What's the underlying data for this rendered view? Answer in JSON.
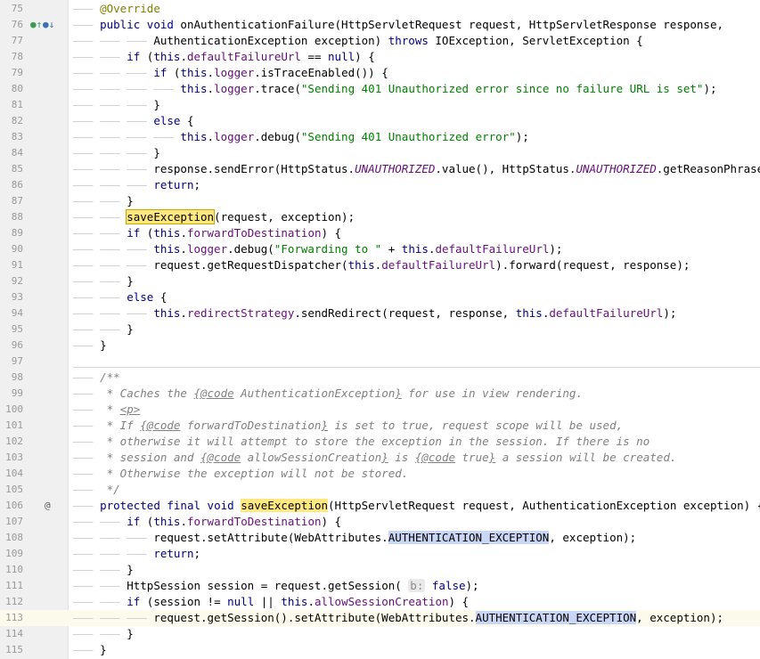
{
  "editor": {
    "current_line": "113",
    "lines": [
      {
        "n": "75",
        "t": [
          [
            "ind",
            "——— "
          ],
          [
            "ann",
            "@Override"
          ]
        ]
      },
      {
        "n": "76",
        "g": "override",
        "t": [
          [
            "ind",
            "——— "
          ],
          [
            "kw",
            "public"
          ],
          [
            "p",
            " "
          ],
          [
            "kw",
            "void"
          ],
          [
            "p",
            " onAuthenticationFailure(HttpServletRequest request, HttpServletResponse response,"
          ]
        ]
      },
      {
        "n": "77",
        "t": [
          [
            "ind",
            "——— ——— ——— "
          ],
          [
            "p",
            "AuthenticationException exception) "
          ],
          [
            "kw",
            "throws"
          ],
          [
            "p",
            " IOException, ServletException {"
          ]
        ]
      },
      {
        "n": "78",
        "t": [
          [
            "ind",
            "——— ——— "
          ],
          [
            "kw",
            "if"
          ],
          [
            "p",
            " ("
          ],
          [
            "kw",
            "this"
          ],
          [
            "p",
            "."
          ],
          [
            "fld",
            "defaultFailureUrl"
          ],
          [
            "p",
            " == "
          ],
          [
            "kw",
            "null"
          ],
          [
            "p",
            ") {"
          ]
        ]
      },
      {
        "n": "79",
        "t": [
          [
            "ind",
            "——— ——— ——— "
          ],
          [
            "kw",
            "if"
          ],
          [
            "p",
            " ("
          ],
          [
            "kw",
            "this"
          ],
          [
            "p",
            "."
          ],
          [
            "fld",
            "logger"
          ],
          [
            "p",
            ".isTraceEnabled()) {"
          ]
        ]
      },
      {
        "n": "80",
        "t": [
          [
            "ind",
            "——— ——— ——— ——— "
          ],
          [
            "kw",
            "this"
          ],
          [
            "p",
            "."
          ],
          [
            "fld",
            "logger"
          ],
          [
            "p",
            ".trace("
          ],
          [
            "str",
            "\"Sending 401 Unauthorized error since no failure URL is set\""
          ],
          [
            "p",
            ");"
          ]
        ]
      },
      {
        "n": "81",
        "t": [
          [
            "ind",
            "——— ——— ——— "
          ],
          [
            "p",
            "}"
          ]
        ]
      },
      {
        "n": "82",
        "t": [
          [
            "ind",
            "——— ——— ——— "
          ],
          [
            "kw",
            "else"
          ],
          [
            "p",
            " {"
          ]
        ]
      },
      {
        "n": "83",
        "t": [
          [
            "ind",
            "——— ——— ——— ——— "
          ],
          [
            "kw",
            "this"
          ],
          [
            "p",
            "."
          ],
          [
            "fld",
            "logger"
          ],
          [
            "p",
            ".debug("
          ],
          [
            "str",
            "\"Sending 401 Unauthorized error\""
          ],
          [
            "p",
            ");"
          ]
        ]
      },
      {
        "n": "84",
        "t": [
          [
            "ind",
            "——— ——— ——— "
          ],
          [
            "p",
            "}"
          ]
        ]
      },
      {
        "n": "85",
        "t": [
          [
            "ind",
            "——— ——— ——— "
          ],
          [
            "p",
            "response.sendError(HttpStatus."
          ],
          [
            "sfld",
            "UNAUTHORIZED"
          ],
          [
            "p",
            ".value(), HttpStatus."
          ],
          [
            "sfld",
            "UNAUTHORIZED"
          ],
          [
            "p",
            ".getReasonPhrase());"
          ]
        ]
      },
      {
        "n": "86",
        "t": [
          [
            "ind",
            "——— ——— ——— "
          ],
          [
            "kw",
            "return"
          ],
          [
            "p",
            ";"
          ]
        ]
      },
      {
        "n": "87",
        "t": [
          [
            "ind",
            "——— ——— "
          ],
          [
            "p",
            "}"
          ]
        ]
      },
      {
        "n": "88",
        "t": [
          [
            "ind",
            "——— ——— "
          ],
          [
            "hl",
            "saveException"
          ],
          [
            "p",
            "(request, exception);"
          ]
        ]
      },
      {
        "n": "89",
        "t": [
          [
            "ind",
            "——— ——— "
          ],
          [
            "kw",
            "if"
          ],
          [
            "p",
            " ("
          ],
          [
            "kw",
            "this"
          ],
          [
            "p",
            "."
          ],
          [
            "fld",
            "forwardToDestination"
          ],
          [
            "p",
            ") {"
          ]
        ]
      },
      {
        "n": "90",
        "t": [
          [
            "ind",
            "——— ——— ——— "
          ],
          [
            "kw",
            "this"
          ],
          [
            "p",
            "."
          ],
          [
            "fld",
            "logger"
          ],
          [
            "p",
            ".debug("
          ],
          [
            "str",
            "\"Forwarding to \""
          ],
          [
            "p",
            " + "
          ],
          [
            "kw",
            "this"
          ],
          [
            "p",
            "."
          ],
          [
            "fld",
            "defaultFailureUrl"
          ],
          [
            "p",
            ");"
          ]
        ]
      },
      {
        "n": "91",
        "t": [
          [
            "ind",
            "——— ——— ——— "
          ],
          [
            "p",
            "request.getRequestDispatcher("
          ],
          [
            "kw",
            "this"
          ],
          [
            "p",
            "."
          ],
          [
            "fld",
            "defaultFailureUrl"
          ],
          [
            "p",
            ").forward(request, response);"
          ]
        ]
      },
      {
        "n": "92",
        "t": [
          [
            "ind",
            "——— ——— "
          ],
          [
            "p",
            "}"
          ]
        ]
      },
      {
        "n": "93",
        "t": [
          [
            "ind",
            "——— ——— "
          ],
          [
            "kw",
            "else"
          ],
          [
            "p",
            " {"
          ]
        ]
      },
      {
        "n": "94",
        "t": [
          [
            "ind",
            "——— ——— ——— "
          ],
          [
            "kw",
            "this"
          ],
          [
            "p",
            "."
          ],
          [
            "fld",
            "redirectStrategy"
          ],
          [
            "p",
            ".sendRedirect(request, response, "
          ],
          [
            "kw",
            "this"
          ],
          [
            "p",
            "."
          ],
          [
            "fld",
            "defaultFailureUrl"
          ],
          [
            "p",
            ");"
          ]
        ]
      },
      {
        "n": "95",
        "t": [
          [
            "ind",
            "——— ——— "
          ],
          [
            "p",
            "}"
          ]
        ]
      },
      {
        "n": "96",
        "t": [
          [
            "ind",
            "——— "
          ],
          [
            "p",
            "}"
          ]
        ]
      },
      {
        "n": "97",
        "t": []
      },
      {
        "n": "98",
        "t": [
          [
            "ind",
            "——— "
          ],
          [
            "cmt",
            "/**"
          ]
        ]
      },
      {
        "n": "99",
        "t": [
          [
            "ind",
            "——— "
          ],
          [
            "cmt",
            " * Caches the "
          ],
          [
            "tag",
            "{@code"
          ],
          [
            "cmt",
            " AuthenticationException"
          ],
          [
            "tag",
            "}"
          ],
          [
            "cmt",
            " for use in view rendering."
          ]
        ]
      },
      {
        "n": "100",
        "t": [
          [
            "ind",
            "——— "
          ],
          [
            "cmt",
            " * "
          ],
          [
            "tag",
            "<p>"
          ]
        ]
      },
      {
        "n": "101",
        "t": [
          [
            "ind",
            "——— "
          ],
          [
            "cmt",
            " * If "
          ],
          [
            "tag",
            "{@code"
          ],
          [
            "cmt",
            " forwardToDestination"
          ],
          [
            "tag",
            "}"
          ],
          [
            "cmt",
            " is set to true, request scope will be used,"
          ]
        ]
      },
      {
        "n": "102",
        "t": [
          [
            "ind",
            "——— "
          ],
          [
            "cmt",
            " * otherwise it will attempt to store the exception in the session. If there is no"
          ]
        ]
      },
      {
        "n": "103",
        "t": [
          [
            "ind",
            "——— "
          ],
          [
            "cmt",
            " * session and "
          ],
          [
            "tag",
            "{@code"
          ],
          [
            "cmt",
            " allowSessionCreation"
          ],
          [
            "tag",
            "}"
          ],
          [
            "cmt",
            " is "
          ],
          [
            "tag",
            "{@code"
          ],
          [
            "cmt",
            " true"
          ],
          [
            "tag",
            "}"
          ],
          [
            "cmt",
            " a session will be created."
          ]
        ]
      },
      {
        "n": "104",
        "t": [
          [
            "ind",
            "——— "
          ],
          [
            "cmt",
            " * Otherwise the exception will not be stored."
          ]
        ]
      },
      {
        "n": "105",
        "t": [
          [
            "ind",
            "——— "
          ],
          [
            "cmt",
            " */"
          ]
        ]
      },
      {
        "n": "106",
        "g": "at",
        "t": [
          [
            "ind",
            "——— "
          ],
          [
            "kw",
            "protected"
          ],
          [
            "p",
            " "
          ],
          [
            "kw",
            "final"
          ],
          [
            "p",
            " "
          ],
          [
            "kw",
            "void"
          ],
          [
            "p",
            " "
          ],
          [
            "hl2",
            "saveException"
          ],
          [
            "p",
            "(HttpServletRequest request, AuthenticationException exception) {"
          ]
        ]
      },
      {
        "n": "107",
        "t": [
          [
            "ind",
            "——— ——— "
          ],
          [
            "kw",
            "if"
          ],
          [
            "p",
            " ("
          ],
          [
            "kw",
            "this"
          ],
          [
            "p",
            "."
          ],
          [
            "fld",
            "forwardToDestination"
          ],
          [
            "p",
            ") {"
          ]
        ]
      },
      {
        "n": "108",
        "t": [
          [
            "ind",
            "——— ——— ——— "
          ],
          [
            "p",
            "request.setAttribute(WebAttributes."
          ],
          [
            "usage",
            "AUTHENTICATION_EXCEPTION"
          ],
          [
            "p",
            ", exception);"
          ]
        ]
      },
      {
        "n": "109",
        "t": [
          [
            "ind",
            "——— ——— ——— "
          ],
          [
            "kw",
            "return"
          ],
          [
            "p",
            ";"
          ]
        ]
      },
      {
        "n": "110",
        "t": [
          [
            "ind",
            "——— ——— "
          ],
          [
            "p",
            "}"
          ]
        ]
      },
      {
        "n": "111",
        "t": [
          [
            "ind",
            "——— ——— "
          ],
          [
            "p",
            "HttpSession session = request.getSession( "
          ],
          [
            "hint",
            "b:"
          ],
          [
            "p",
            " "
          ],
          [
            "kw",
            "false"
          ],
          [
            "p",
            ");"
          ]
        ]
      },
      {
        "n": "112",
        "t": [
          [
            "ind",
            "——— ——— "
          ],
          [
            "kw",
            "if"
          ],
          [
            "p",
            " (session != "
          ],
          [
            "kw",
            "null"
          ],
          [
            "p",
            " || "
          ],
          [
            "kw",
            "this"
          ],
          [
            "p",
            "."
          ],
          [
            "fld",
            "allowSessionCreation"
          ],
          [
            "p",
            ") {"
          ]
        ]
      },
      {
        "n": "113",
        "t": [
          [
            "ind",
            "——— ——— ——— "
          ],
          [
            "p",
            "request.getSession().setAttribute(WebAttributes."
          ],
          [
            "usage",
            "AUTHENTICATION_EXCEPTION"
          ],
          [
            "p",
            ", exception);"
          ]
        ]
      },
      {
        "n": "114",
        "t": [
          [
            "ind",
            "——— ——— "
          ],
          [
            "p",
            "}"
          ]
        ]
      },
      {
        "n": "115",
        "t": [
          [
            "ind",
            "——— "
          ],
          [
            "p",
            "}"
          ]
        ]
      }
    ]
  },
  "gutter_icons": {
    "implements": "implements-icon",
    "overrides": "overrides-icon",
    "annotation": "annotation-icon"
  }
}
